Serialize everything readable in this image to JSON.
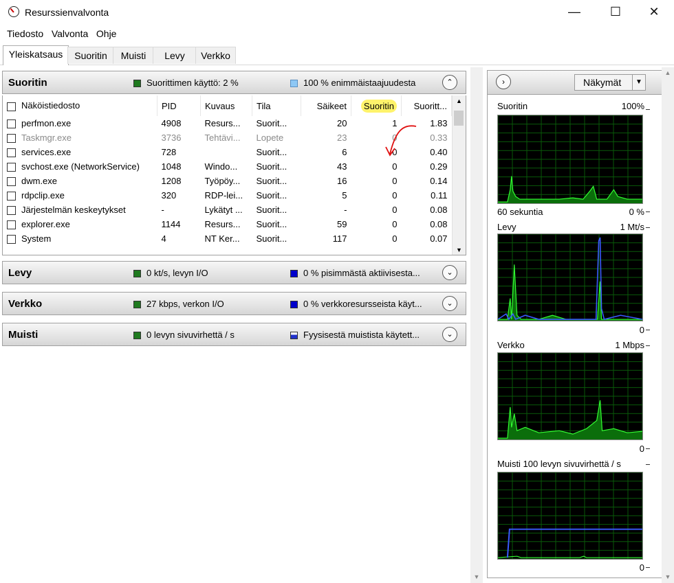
{
  "window": {
    "title": "Resurssienvalvonta",
    "minimize": "—",
    "maximize": "☐",
    "close": "✕"
  },
  "menu": [
    "Tiedosto",
    "Valvonta",
    "Ohje"
  ],
  "tabs": [
    "Yleiskatsaus",
    "Suoritin",
    "Muisti",
    "Levy",
    "Verkko"
  ],
  "sections": {
    "cpu": {
      "title": "Suoritin",
      "stat1": "Suorittimen käyttö: 2 %",
      "stat2": "100 % enimmäistaajuudesta",
      "stat1_color": "#1f7a1f",
      "stat2_color": "#8ec8f5"
    },
    "disk": {
      "title": "Levy",
      "stat1": "0 kt/s, levyn I/O",
      "stat2": "0 % pisimmästä aktiivisesta...",
      "stat1_color": "#1f7a1f",
      "stat2_color": "#0000cc"
    },
    "network": {
      "title": "Verkko",
      "stat1": "27 kbps, verkon I/O",
      "stat2": "0 % verkkoresursseista käyt...",
      "stat1_color": "#1f7a1f",
      "stat2_color": "#0000cc"
    },
    "memory": {
      "title": "Muisti",
      "stat1": "0 levyn sivuvirhettä / s",
      "stat2": "Fyysisestä muistista käytett...",
      "stat1_color": "#1f7a1f",
      "stat2_color": "#2233cc"
    }
  },
  "process_table": {
    "columns": [
      "Näköistiedosto",
      "PID",
      "Kuvaus",
      "Tila",
      "Säikeet",
      "Suoritin",
      "Suoritt..."
    ],
    "rows": [
      {
        "name": "perfmon.exe",
        "pid": "4908",
        "desc": "Resurs...",
        "state": "Suorit...",
        "threads": "20",
        "cpu": "1",
        "avg": "1.83",
        "ended": false
      },
      {
        "name": "Taskmgr.exe",
        "pid": "3736",
        "desc": "Tehtävi...",
        "state": "Lopete",
        "threads": "23",
        "cpu": "0",
        "avg": "0.33",
        "ended": true
      },
      {
        "name": "services.exe",
        "pid": "728",
        "desc": "",
        "state": "Suorit...",
        "threads": "6",
        "cpu": "0",
        "avg": "0.40",
        "ended": false
      },
      {
        "name": "svchost.exe (NetworkService)",
        "pid": "1048",
        "desc": "Windo...",
        "state": "Suorit...",
        "threads": "43",
        "cpu": "0",
        "avg": "0.29",
        "ended": false
      },
      {
        "name": "dwm.exe",
        "pid": "1208",
        "desc": "Työpöy...",
        "state": "Suorit...",
        "threads": "16",
        "cpu": "0",
        "avg": "0.14",
        "ended": false
      },
      {
        "name": "rdpclip.exe",
        "pid": "320",
        "desc": "RDP-lei...",
        "state": "Suorit...",
        "threads": "5",
        "cpu": "0",
        "avg": "0.11",
        "ended": false
      },
      {
        "name": "Järjestelmän keskeytykset",
        "pid": "-",
        "desc": "Lykätyt ...",
        "state": "Suorit...",
        "threads": "-",
        "cpu": "0",
        "avg": "0.08",
        "ended": false
      },
      {
        "name": "explorer.exe",
        "pid": "1144",
        "desc": "Resurs...",
        "state": "Suorit...",
        "threads": "59",
        "cpu": "0",
        "avg": "0.08",
        "ended": false
      },
      {
        "name": "System",
        "pid": "4",
        "desc": "NT Ker...",
        "state": "Suorit...",
        "threads": "117",
        "cpu": "0",
        "avg": "0.07",
        "ended": false
      }
    ]
  },
  "right_panel": {
    "views_label": "Näkymät",
    "graphs": [
      {
        "label": "Suoritin",
        "max": "100%",
        "min_label_left": "60 sekuntia",
        "min": "0 %"
      },
      {
        "label": "Levy",
        "max": "1 Mt/s",
        "min": "0"
      },
      {
        "label": "Verkko",
        "max": "1 Mbps",
        "min": "0"
      },
      {
        "label": "Muisti 100 levyn sivuvirhettä / s",
        "max": "",
        "min": "0"
      }
    ]
  }
}
